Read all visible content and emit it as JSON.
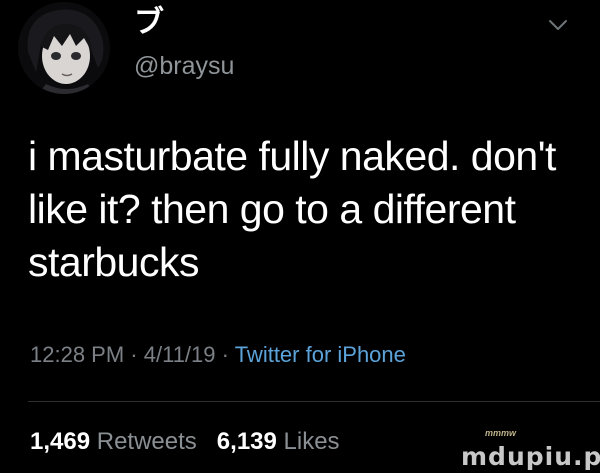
{
  "user": {
    "display_name": "ブ",
    "handle": "@braysu"
  },
  "tweet": {
    "text": "i masturbate fully naked. don't like it? then go to a different starbucks"
  },
  "meta": {
    "time": "12:28 PM",
    "separator": "·",
    "date": "4/11/19",
    "source": "Twitter for iPhone"
  },
  "stats": {
    "retweets_count": "1,469",
    "retweets_label": "Retweets",
    "likes_count": "6,139",
    "likes_label": "Likes"
  },
  "watermark": {
    "logo_text": "mmmw",
    "site_text": "mdupiu.pl"
  },
  "icons": {
    "chevron": "chevron-down-icon"
  },
  "colors": {
    "background": "#000000",
    "text": "#ffffff",
    "secondary_text": "#8f9599",
    "link": "#5ba3d9"
  }
}
